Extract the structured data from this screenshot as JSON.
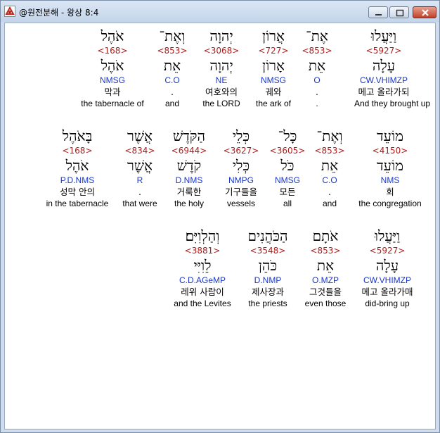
{
  "window": {
    "title": "@원전분해 - 왕상 8:4"
  },
  "verse_rows": [
    [
      {
        "heb": "וַיַּעֲלוּ",
        "strong": "<5927>",
        "lemma": "עָלָה",
        "morph": "CW.VHIMZP",
        "kor": "메고 올라가되",
        "eng": "And they brought up"
      },
      {
        "heb": "אֶת־",
        "strong": "<853>",
        "lemma": "אֵת",
        "morph": "O",
        "kor": ".",
        "eng": "."
      },
      {
        "heb": "אֲרוֹן",
        "strong": "<727>",
        "lemma": "אָרוֹן",
        "morph": "NMSG",
        "kor": "궤와",
        "eng": "the ark of"
      },
      {
        "heb": "יְהוָה",
        "strong": "<3068>",
        "lemma": "יְהוָה",
        "morph": "NE",
        "kor": "여호와의",
        "eng": "the LORD"
      },
      {
        "heb": "וְאֶת־",
        "strong": "<853>",
        "lemma": "אֵת",
        "morph": "C.O",
        "kor": ".",
        "eng": "and"
      },
      {
        "heb": "אֹהֶל",
        "strong": "<168>",
        "lemma": "אֹהֶל",
        "morph": "NMSG",
        "kor": "막과",
        "eng": "the tabernacle of"
      }
    ],
    [
      {
        "heb": "מוֹעֵד",
        "strong": "<4150>",
        "lemma": "מוֹעֵד",
        "morph": "NMS",
        "kor": "회",
        "eng": "the congregation"
      },
      {
        "heb": "וְאֶת־",
        "strong": "<853>",
        "lemma": "אֵת",
        "morph": "C.O",
        "kor": ".",
        "eng": "and"
      },
      {
        "heb": "כָּל־",
        "strong": "<3605>",
        "lemma": "כֹּל",
        "morph": "NMSG",
        "kor": "모든",
        "eng": "all"
      },
      {
        "heb": "כְּלֵי",
        "strong": "<3627>",
        "lemma": "כְּלִי",
        "morph": "NMPG",
        "kor": "기구들을",
        "eng": "vessels"
      },
      {
        "heb": "הַקֹּדֶשׁ",
        "strong": "<6944>",
        "lemma": "קֹדֶשׁ",
        "morph": "D.NMS",
        "kor": "거룩한",
        "eng": "the holy"
      },
      {
        "heb": "אֲשֶׁר",
        "strong": "<834>",
        "lemma": "אֲשֶׁר",
        "morph": "R",
        "kor": ".",
        "eng": "that were"
      },
      {
        "heb": "בָּאֹהֶל",
        "strong": "<168>",
        "lemma": "אֹהֶל",
        "morph": "P.D.NMS",
        "kor": "성막 안의",
        "eng": "in the tabernacle"
      }
    ],
    [
      {
        "heb": "וַיַּעֲלוּ",
        "strong": "<5927>",
        "lemma": "עָלָה",
        "morph": "CW.VHIMZP",
        "kor": "메고 올라가매",
        "eng": "did-bring up"
      },
      {
        "heb": "אֹתָם",
        "strong": "<853>",
        "lemma": "אֵת",
        "morph": "O.MZP",
        "kor": "그것들을",
        "eng": "even those"
      },
      {
        "heb": "הַכֹּהֲנִים",
        "strong": "<3548>",
        "lemma": "כֹּהֵן",
        "morph": "D.NMP",
        "kor": "제사장과",
        "eng": "the priests"
      },
      {
        "heb": "וְהַלְוִיִּם׃",
        "strong": "<3881>",
        "lemma": "לֵוִיִּי",
        "morph": "C.D.AGeMP",
        "kor": "레위 사람이",
        "eng": "and the Levites"
      }
    ]
  ]
}
